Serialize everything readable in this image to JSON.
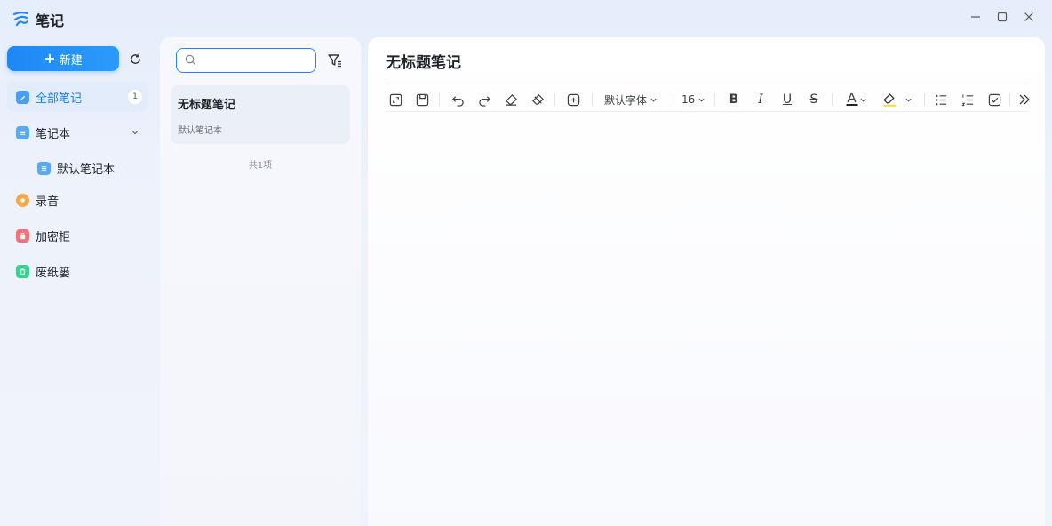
{
  "app": {
    "title": "笔记"
  },
  "sidebar": {
    "new_label": "新建",
    "items": [
      {
        "label": "全部笔记",
        "badge": "1",
        "icon": "all-notes-icon",
        "active": true
      },
      {
        "label": "笔记本",
        "icon": "notebook-icon"
      },
      {
        "label": "默认笔记本",
        "icon": "notebook-icon"
      },
      {
        "label": "录音",
        "icon": "recording-icon"
      },
      {
        "label": "加密柜",
        "icon": "lock-icon"
      },
      {
        "label": "废纸篓",
        "icon": "trash-icon"
      }
    ]
  },
  "list": {
    "search": {
      "placeholder": "",
      "value": ""
    },
    "notes": [
      {
        "title": "无标题笔记",
        "notebook": "默认笔记本"
      }
    ],
    "count": "共1项"
  },
  "editor": {
    "title": "无标题笔记",
    "font_family": "默认字体",
    "font_size": "16"
  },
  "colors": {
    "accent": "#1e88f5",
    "active_bg": "#e3ecfa"
  }
}
